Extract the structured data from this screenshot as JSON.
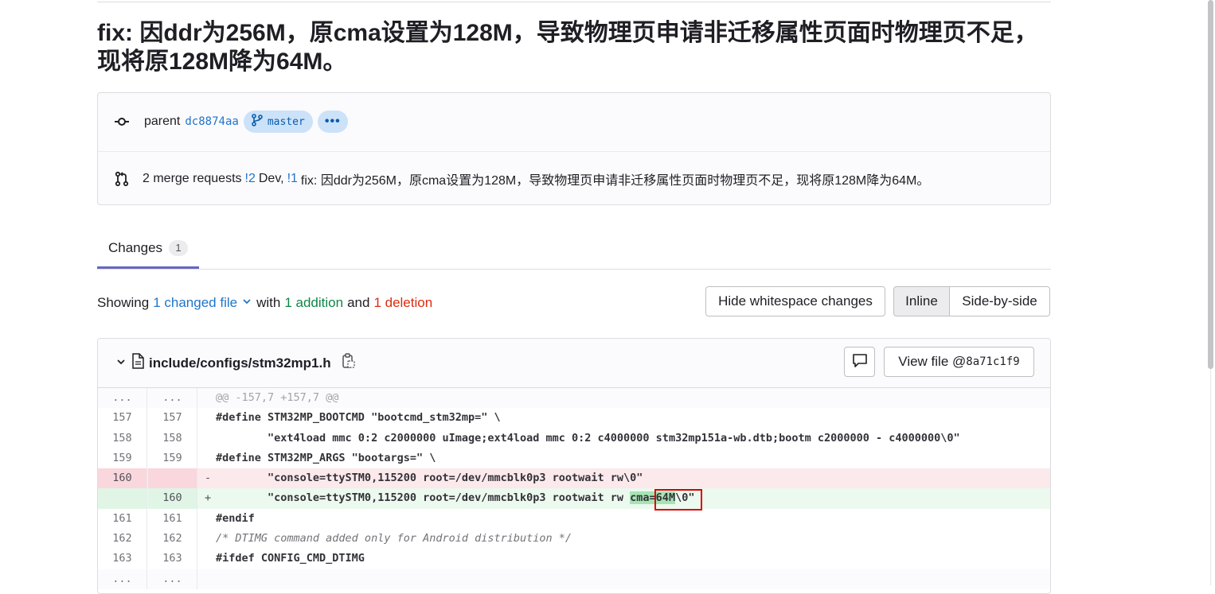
{
  "commit": {
    "title": "fix: 因ddr为256M，原cma设置为128M，导致物理页申请非迁移属性页面时物理页不足，现将原128M降为64M。",
    "parent_label": "parent",
    "parent_sha": "dc8874aa",
    "branch": "master",
    "more_label": "•••",
    "merge_requests_label": "2 merge requests",
    "mr1_ref": "!2",
    "mr1_title": "Dev,",
    "mr2_ref": "!1",
    "mr2_title": "fix: 因ddr为256M，原cma设置为128M，导致物理页申请非迁移属性页面时物理页不足，现将原128M降为64M。"
  },
  "tabs": [
    {
      "label": "Changes",
      "count": "1"
    }
  ],
  "summary": {
    "showing": "Showing",
    "changed_files": "1 changed file",
    "with": "with",
    "additions": "1 addition",
    "and": "and",
    "deletions": "1 deletion"
  },
  "toolbar": {
    "whitespace": "Hide whitespace changes",
    "inline": "Inline",
    "side_by_side": "Side-by-side"
  },
  "file": {
    "path": "include/configs/stm32mp1.h",
    "view_file": "View file @",
    "sha": "8a71c1f9"
  },
  "diff_lines": [
    {
      "type": "hunk",
      "old": "...",
      "new": "...",
      "sign": "",
      "code": "@@ -157,7 +157,7 @@"
    },
    {
      "type": "ctx",
      "old": "157",
      "new": "157",
      "sign": "",
      "code": "#define STM32MP_BOOTCMD \"bootcmd_stm32mp=\" \\"
    },
    {
      "type": "ctx",
      "old": "158",
      "new": "158",
      "sign": "",
      "code": "        \"ext4load mmc 0:2 c2000000 uImage;ext4load mmc 0:2 c4000000 stm32mp151a-wb.dtb;bootm c2000000 - c4000000\\0\""
    },
    {
      "type": "ctx",
      "old": "159",
      "new": "159",
      "sign": "",
      "code": "#define STM32MP_ARGS \"bootargs=\" \\"
    },
    {
      "type": "del",
      "old": "160",
      "new": "",
      "sign": "-",
      "code": "        \"console=ttySTM0,115200 root=/dev/mmcblk0p3 rootwait rw\\0\""
    },
    {
      "type": "add",
      "old": "",
      "new": "160",
      "sign": "+",
      "code_pre": "        \"console=ttySTM0,115200 root=/dev/mmcblk0p3 rootwait rw ",
      "code_hl": "cma=64M",
      "code_post": "\\0\""
    },
    {
      "type": "ctx",
      "old": "161",
      "new": "161",
      "sign": "",
      "code": "#endif"
    },
    {
      "type": "ctx",
      "old": "162",
      "new": "162",
      "sign": "",
      "code": "/* DTIMG command added only for Android distribution */"
    },
    {
      "type": "ctx",
      "old": "163",
      "new": "163",
      "sign": "",
      "code": "#ifdef CONFIG_CMD_DTIMG"
    },
    {
      "type": "hunk",
      "old": "...",
      "new": "...",
      "sign": "",
      "code": ""
    }
  ]
}
